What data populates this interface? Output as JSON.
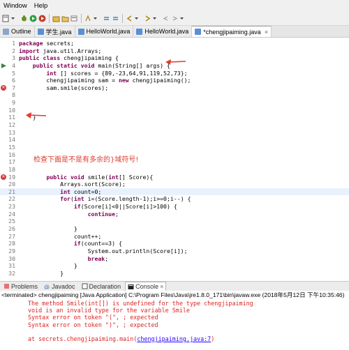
{
  "menu": {
    "items": [
      "Window",
      "Help"
    ]
  },
  "editor_tabs": [
    {
      "label": "Outline",
      "icon": "outline-icon",
      "active": false
    },
    {
      "label": "学生.java",
      "icon": "java-file-icon",
      "active": false
    },
    {
      "label": "HelloWorld.java",
      "icon": "java-file-icon",
      "active": false
    },
    {
      "label": "HelloWorld.java",
      "icon": "java-file-icon",
      "active": false
    },
    {
      "label": "*chengjipaiming.java",
      "icon": "java-file-icon",
      "active": true
    }
  ],
  "tab_close_symbol": "×",
  "code_lines": [
    {
      "n": "1",
      "text": "package secrets;"
    },
    {
      "n": "2",
      "text": "import java.util.Arrays;"
    },
    {
      "n": "3",
      "text": "public class chengjipaiming {"
    },
    {
      "n": "4",
      "text": "    public static void main(String[] args) {"
    },
    {
      "n": "5",
      "text": "        int [] scores = {89,-23,64,91,119,52,73};"
    },
    {
      "n": "6",
      "text": "        chengjipaiming sam = new chengjipaiming();"
    },
    {
      "n": "7",
      "text": "        sam.smile(scores);"
    },
    {
      "n": "8",
      "text": ""
    },
    {
      "n": "9",
      "text": ""
    },
    {
      "n": "10",
      "text": ""
    },
    {
      "n": "11",
      "text": "    }"
    },
    {
      "n": "12",
      "text": ""
    },
    {
      "n": "13",
      "text": ""
    },
    {
      "n": "14",
      "text": ""
    },
    {
      "n": "15",
      "text": ""
    },
    {
      "n": "16",
      "text": ""
    },
    {
      "n": "17",
      "text": ""
    },
    {
      "n": "18",
      "text": ""
    },
    {
      "n": "19",
      "text": "        public void smile(int[] Score){"
    },
    {
      "n": "20",
      "text": "            Arrays.sort(Score);"
    },
    {
      "n": "21",
      "text": "            int count=0;"
    },
    {
      "n": "22",
      "text": "            for(int i=(Score.length-1);i>=0;i--) {"
    },
    {
      "n": "23",
      "text": "                if(Score[i]<0||Score[i]>100) {"
    },
    {
      "n": "24",
      "text": "                    continue;"
    },
    {
      "n": "25",
      "text": ""
    },
    {
      "n": "26",
      "text": "                }"
    },
    {
      "n": "27",
      "text": "                count++;"
    },
    {
      "n": "28",
      "text": "                if(count==3) {"
    },
    {
      "n": "29",
      "text": "                    System.out.println(Score[i]);"
    },
    {
      "n": "30",
      "text": "                    break;"
    },
    {
      "n": "31",
      "text": "                }"
    },
    {
      "n": "32",
      "text": "            }"
    }
  ],
  "annotation_text": "检查下面是不是有多余的}域符号!",
  "bottom_tabs": [
    {
      "label": "Problems",
      "icon": "problems-icon",
      "active": false
    },
    {
      "label": "Javadoc",
      "icon": "javadoc-icon",
      "active": false
    },
    {
      "label": "Declaration",
      "icon": "declaration-icon",
      "active": false
    },
    {
      "label": "Console",
      "icon": "console-icon",
      "active": true
    }
  ],
  "console_header": "<terminated> chengjipaiming [Java Application] C:\\Program Files\\Java\\jre1.8.0_171\\bin\\javaw.exe (2018年5月12日 下午10:35:46)",
  "console_lines": [
    "The method Smile(int[]) is undefined for the type chengjipaiming",
    "void is an invalid type for the variable Smile",
    "Syntax error on token \"(\", ; expected",
    "Syntax error on token \")\", ; expected",
    ""
  ],
  "console_trace_prefix": "at secrets.chengjipaiming.main(",
  "console_trace_link": "chengjipaiming.java:7",
  "console_trace_suffix": ")",
  "colors": {
    "keyword": "#7f0055",
    "error": "#dd2222",
    "link": "#2a00ff",
    "annotation": "#e0392e"
  }
}
